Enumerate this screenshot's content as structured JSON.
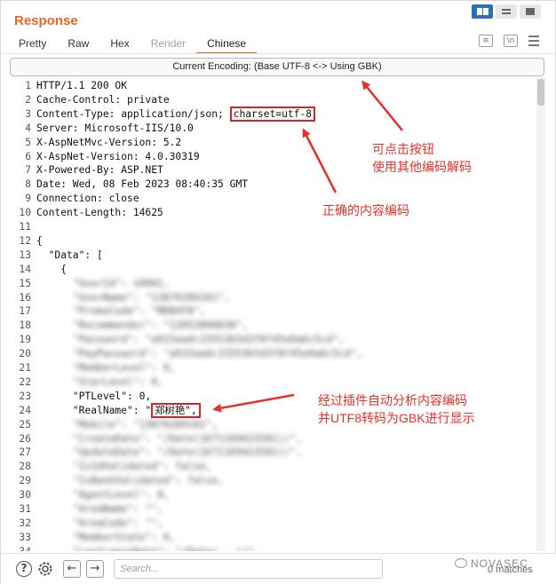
{
  "panel": {
    "title": "Response",
    "tabs": [
      {
        "label": "Pretty",
        "state": "normal"
      },
      {
        "label": "Raw",
        "state": "normal"
      },
      {
        "label": "Hex",
        "state": "normal"
      },
      {
        "label": "Render",
        "state": "disabled"
      },
      {
        "label": "Chinese",
        "state": "active"
      }
    ],
    "tool_icons": {
      "pretty_icon": "≡",
      "wrap_icon": "\\n",
      "menu_icon": "menu-icon"
    },
    "accent_color": "#e8642c",
    "toggle_active_color": "#2f6fba"
  },
  "encoding_button": {
    "label": "Current Encoding: (Base UTF-8 <-> Using GBK)"
  },
  "editor": {
    "lines": [
      {
        "num": "1",
        "text": "HTTP/1.1 200 OK"
      },
      {
        "num": "2",
        "text": "Cache-Control: private"
      },
      {
        "num": "3",
        "text": "Content-Type: application/json; ",
        "highlight": "charset=utf-8"
      },
      {
        "num": "4",
        "text": "Server: Microsoft-IIS/10.0"
      },
      {
        "num": "5",
        "text": "X-AspNetMvc-Version: 5.2"
      },
      {
        "num": "6",
        "text": "X-AspNet-Version: 4.0.30319"
      },
      {
        "num": "7",
        "text": "X-Powered-By: ASP.NET"
      },
      {
        "num": "8",
        "text": "Date: Wed, 08 Feb 2023 08:40:35 GMT"
      },
      {
        "num": "9",
        "text": "Connection: close"
      },
      {
        "num": "10",
        "text": "Content-Length: 14625"
      },
      {
        "num": "11",
        "text": ""
      },
      {
        "num": "12",
        "text": "{"
      },
      {
        "num": "13",
        "text": "  \"Data\": ["
      },
      {
        "num": "14",
        "text": "    {"
      },
      {
        "num": "15",
        "text": "      \"UserId\": 10001,",
        "blurred": true
      },
      {
        "num": "16",
        "text": "      \"UserName\": \"13870289181\",",
        "blurred": true
      },
      {
        "num": "17",
        "text": "      \"PromoCode\": \"MDB4F8\",",
        "blurred": true
      },
      {
        "num": "18",
        "text": "      \"Recommender\": \"13952808838\",",
        "blurred": true
      },
      {
        "num": "19",
        "text": "      \"Password\": \"a915aadc15553b5d3f8f45e0a6c5cd\",",
        "blurred": true
      },
      {
        "num": "20",
        "text": "      \"PayPassword\": \"a915aadc15553b5d3f8f45e0a6c5cd\",",
        "blurred": true
      },
      {
        "num": "21",
        "text": "      \"MemberLevel\": 0,",
        "blurred": true
      },
      {
        "num": "22",
        "text": "      \"StarLevel\": 0,",
        "blurred": true
      },
      {
        "num": "23",
        "text": "      \"PTLevel\": 0,"
      },
      {
        "num": "24",
        "text": "      \"RealName\": \"",
        "highlight": "郑树艳\","
      },
      {
        "num": "25",
        "text": "      \"Mobile\": \"13870289181\",",
        "blurred": true
      },
      {
        "num": "26",
        "text": "      \"CreateDate\": \"/Date(1671169423581)/\",",
        "blurred": true
      },
      {
        "num": "27",
        "text": "      \"UpdateDate\": \"/Date(1671169423581)/\",",
        "blurred": true
      },
      {
        "num": "28",
        "text": "      \"IsIdValidated\": false,",
        "blurred": true
      },
      {
        "num": "29",
        "text": "      \"IsBankValidated\": false,",
        "blurred": true
      },
      {
        "num": "30",
        "text": "      \"AgentLevel\": 0,",
        "blurred": true
      },
      {
        "num": "31",
        "text": "      \"AreaName\": \"\",",
        "blurred": true
      },
      {
        "num": "32",
        "text": "      \"AreaCode\": \"\",",
        "blurred": true
      },
      {
        "num": "33",
        "text": "      \"MemberState\": 0,",
        "blurred": true
      },
      {
        "num": "34",
        "text": "      \"LastLoginDate\": \"/Date(...)/\",",
        "blurred": true
      }
    ]
  },
  "annotations": {
    "encoding_note_line1": "可点击按钮",
    "encoding_note_line2": "使用其他编码解码",
    "charset_note": "正确的内容编码",
    "plugin_note_line1": "经过插件自动分析内容编码",
    "plugin_note_line2": "并UTF8转码为GBK进行显示",
    "color": "#e4312a"
  },
  "bottom_bar": {
    "help_icon": "?",
    "settings_icon": "gear-icon",
    "back_label": "←",
    "forward_label": "→",
    "search_placeholder": "Search...",
    "matches_text": "0 matches",
    "watermark": "NOVASEC"
  }
}
